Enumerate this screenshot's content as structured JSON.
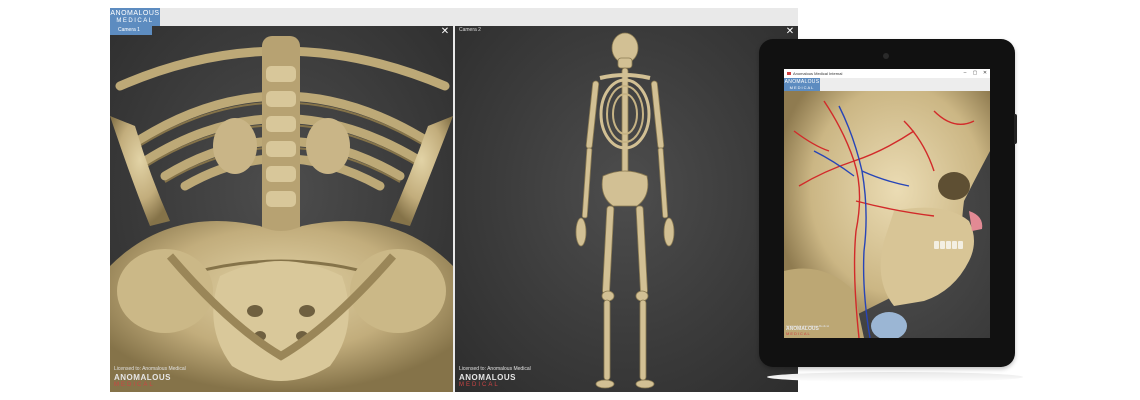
{
  "desktop": {
    "logo": {
      "line1": "ANOMALOUS",
      "line2": "MEDICAL"
    },
    "viewports": [
      {
        "camera_label": "Camera 1",
        "close_glyph": "✕",
        "license": "Licensed to: Anomalous Medical",
        "watermark": {
          "line1": "ANOMALOUS",
          "line2": "MEDICAL"
        },
        "view": "pelvis-and-ribcage-from-below"
      },
      {
        "camera_label": "Camera 2",
        "close_glyph": "✕",
        "license": "Licensed to: Anomalous Medical",
        "watermark": {
          "line1": "ANOMALOUS",
          "line2": "MEDICAL"
        },
        "view": "full-skeleton-front"
      }
    ]
  },
  "tablet": {
    "window_title": "Anomalous Medical Internal",
    "window_controls": {
      "minimize": "–",
      "maximize": "▢",
      "close": "✕"
    },
    "logo": {
      "line1": "ANOMALOUS",
      "line2": "MEDICAL"
    },
    "license": "Licensed to: Anomalous Medical",
    "watermark": {
      "line1": "ANOMALOUS",
      "line2": "MEDICAL"
    },
    "view": "skull-with-vessels-side"
  },
  "colors": {
    "bone": "#cdbb8c",
    "bone_shadow": "#7d6d49",
    "viewport_bg": "#3b3b3b",
    "accent": "#5d8cc0",
    "artery": "#d22a2a",
    "vein": "#2745b8"
  }
}
